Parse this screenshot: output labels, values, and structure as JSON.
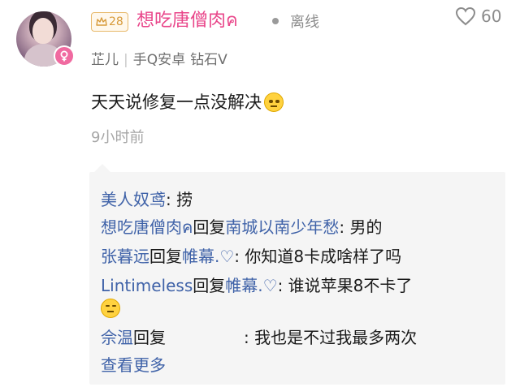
{
  "user": {
    "level": "28",
    "name": "想吃唐僧肉ค",
    "status": "离线",
    "likes": "60",
    "nickname": "芷儿",
    "device": "手Q安卓",
    "vip": "钻石V"
  },
  "post": {
    "content": "天天说修复一点没解决",
    "time": "9小时前"
  },
  "replies": {
    "items": [
      {
        "name": "美人奴鸢",
        "reply_word": "",
        "target": "",
        "text": ": 捞"
      },
      {
        "name": "想吃唐僧肉ค",
        "reply_word": "回复",
        "target": "南城以南少年愁",
        "text": ": 男的"
      },
      {
        "name": "张暮远",
        "reply_word": "回复",
        "target": "帷幕.♡",
        "text": ": 你知道8卡成啥样了吗"
      },
      {
        "name": "Lintimeless",
        "reply_word": "回复",
        "target": "帷幕.♡",
        "text": ": 谁说苹果8不卡了"
      },
      {
        "name": "佘温",
        "reply_word": "回复",
        "target": "",
        "text": ": 我也是不过我最多两次"
      }
    ],
    "more_label": "查看更多"
  },
  "colors": {
    "username": "#e9468a",
    "link": "#3f62a8",
    "level_badge": "#d79a3a",
    "reply_bg": "#f5f5f5"
  },
  "icons": {
    "crown": "crown-icon",
    "heart": "heart-icon",
    "gender": "female-icon",
    "emoji": "emoji-icon"
  }
}
